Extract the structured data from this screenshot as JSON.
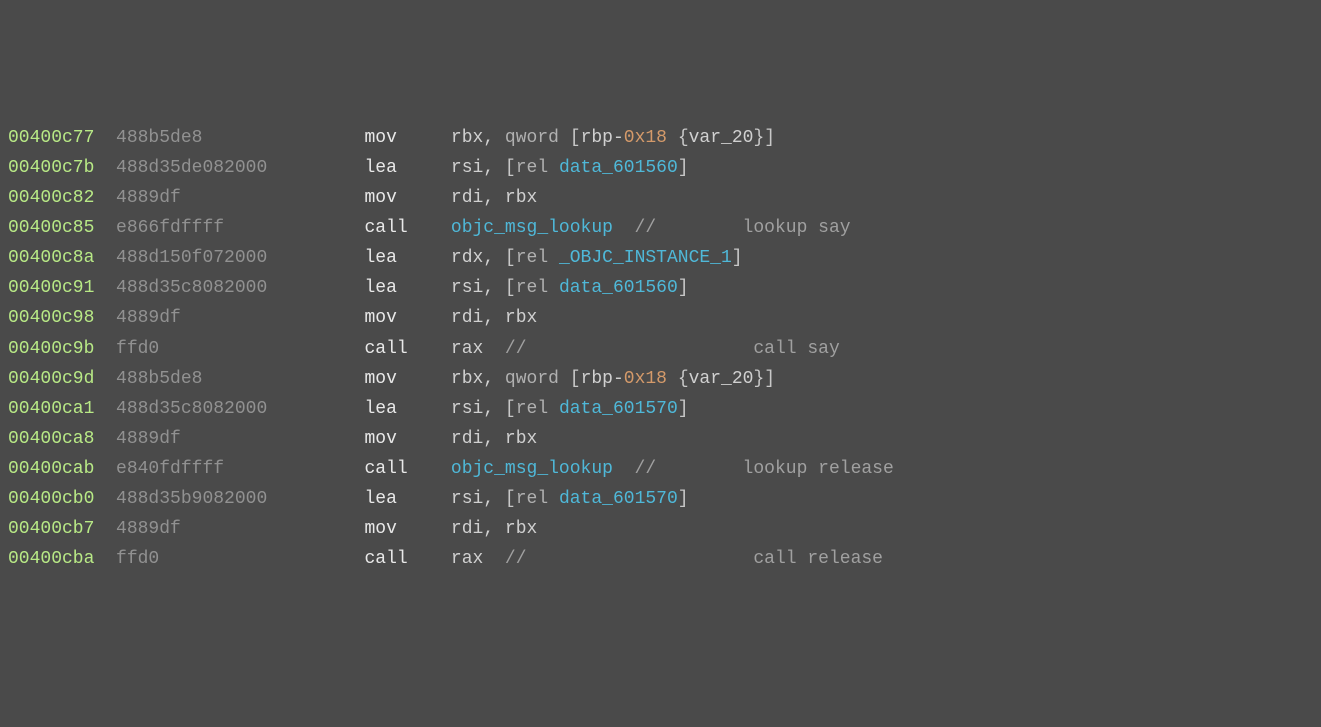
{
  "lines": [
    {
      "addr": "00400c77",
      "hex": "488b5de8",
      "mn": "mov",
      "ops": [
        {
          "t": "reg",
          "v": "rbx"
        },
        {
          "t": "tok",
          "v": ", "
        },
        {
          "t": "kw",
          "v": "qword"
        },
        {
          "t": "tok",
          "v": " "
        },
        {
          "t": "br",
          "v": "["
        },
        {
          "t": "reg",
          "v": "rbp"
        },
        {
          "t": "tok",
          "v": "-"
        },
        {
          "t": "num",
          "v": "0x18"
        },
        {
          "t": "tok",
          "v": " "
        },
        {
          "t": "br",
          "v": "{"
        },
        {
          "t": "reg",
          "v": "var_20"
        },
        {
          "t": "br",
          "v": "}"
        },
        {
          "t": "br",
          "v": "]"
        }
      ]
    },
    {
      "addr": "00400c7b",
      "hex": "488d35de082000",
      "mn": "lea",
      "ops": [
        {
          "t": "reg",
          "v": "rsi"
        },
        {
          "t": "tok",
          "v": ", "
        },
        {
          "t": "br",
          "v": "["
        },
        {
          "t": "kw",
          "v": "rel"
        },
        {
          "t": "tok",
          "v": " "
        },
        {
          "t": "sym",
          "v": "data_601560"
        },
        {
          "t": "br",
          "v": "]"
        }
      ]
    },
    {
      "addr": "00400c82",
      "hex": "4889df",
      "mn": "mov",
      "ops": [
        {
          "t": "reg",
          "v": "rdi"
        },
        {
          "t": "tok",
          "v": ", "
        },
        {
          "t": "reg",
          "v": "rbx"
        }
      ]
    },
    {
      "addr": "00400c85",
      "hex": "e866fdffff",
      "mn": "call",
      "ops": [
        {
          "t": "sym",
          "v": "objc_msg_lookup"
        },
        {
          "t": "cm",
          "v": "  //        lookup say"
        }
      ]
    },
    {
      "addr": "00400c8a",
      "hex": "488d150f072000",
      "mn": "lea",
      "ops": [
        {
          "t": "reg",
          "v": "rdx"
        },
        {
          "t": "tok",
          "v": ", "
        },
        {
          "t": "br",
          "v": "["
        },
        {
          "t": "kw",
          "v": "rel"
        },
        {
          "t": "tok",
          "v": " "
        },
        {
          "t": "sym",
          "v": "_OBJC_INSTANCE_1"
        },
        {
          "t": "br",
          "v": "]"
        }
      ]
    },
    {
      "addr": "00400c91",
      "hex": "488d35c8082000",
      "mn": "lea",
      "ops": [
        {
          "t": "reg",
          "v": "rsi"
        },
        {
          "t": "tok",
          "v": ", "
        },
        {
          "t": "br",
          "v": "["
        },
        {
          "t": "kw",
          "v": "rel"
        },
        {
          "t": "tok",
          "v": " "
        },
        {
          "t": "sym",
          "v": "data_601560"
        },
        {
          "t": "br",
          "v": "]"
        }
      ]
    },
    {
      "addr": "00400c98",
      "hex": "4889df",
      "mn": "mov",
      "ops": [
        {
          "t": "reg",
          "v": "rdi"
        },
        {
          "t": "tok",
          "v": ", "
        },
        {
          "t": "reg",
          "v": "rbx"
        }
      ]
    },
    {
      "addr": "00400c9b",
      "hex": "ffd0",
      "mn": "call",
      "ops": [
        {
          "t": "reg",
          "v": "rax"
        },
        {
          "t": "cm",
          "v": "  //                     call say"
        }
      ]
    },
    {
      "addr": "00400c9d",
      "hex": "488b5de8",
      "mn": "mov",
      "ops": [
        {
          "t": "reg",
          "v": "rbx"
        },
        {
          "t": "tok",
          "v": ", "
        },
        {
          "t": "kw",
          "v": "qword"
        },
        {
          "t": "tok",
          "v": " "
        },
        {
          "t": "br",
          "v": "["
        },
        {
          "t": "reg",
          "v": "rbp"
        },
        {
          "t": "tok",
          "v": "-"
        },
        {
          "t": "num",
          "v": "0x18"
        },
        {
          "t": "tok",
          "v": " "
        },
        {
          "t": "br",
          "v": "{"
        },
        {
          "t": "reg",
          "v": "var_20"
        },
        {
          "t": "br",
          "v": "}"
        },
        {
          "t": "br",
          "v": "]"
        }
      ]
    },
    {
      "addr": "00400ca1",
      "hex": "488d35c8082000",
      "mn": "lea",
      "ops": [
        {
          "t": "reg",
          "v": "rsi"
        },
        {
          "t": "tok",
          "v": ", "
        },
        {
          "t": "br",
          "v": "["
        },
        {
          "t": "kw",
          "v": "rel"
        },
        {
          "t": "tok",
          "v": " "
        },
        {
          "t": "sym",
          "v": "data_601570"
        },
        {
          "t": "br",
          "v": "]"
        }
      ]
    },
    {
      "addr": "00400ca8",
      "hex": "4889df",
      "mn": "mov",
      "ops": [
        {
          "t": "reg",
          "v": "rdi"
        },
        {
          "t": "tok",
          "v": ", "
        },
        {
          "t": "reg",
          "v": "rbx"
        }
      ]
    },
    {
      "addr": "00400cab",
      "hex": "e840fdffff",
      "mn": "call",
      "ops": [
        {
          "t": "sym",
          "v": "objc_msg_lookup"
        },
        {
          "t": "cm",
          "v": "  //        lookup release"
        }
      ]
    },
    {
      "addr": "00400cb0",
      "hex": "488d35b9082000",
      "mn": "lea",
      "ops": [
        {
          "t": "reg",
          "v": "rsi"
        },
        {
          "t": "tok",
          "v": ", "
        },
        {
          "t": "br",
          "v": "["
        },
        {
          "t": "kw",
          "v": "rel"
        },
        {
          "t": "tok",
          "v": " "
        },
        {
          "t": "sym",
          "v": "data_601570"
        },
        {
          "t": "br",
          "v": "]"
        }
      ]
    },
    {
      "addr": "00400cb7",
      "hex": "4889df",
      "mn": "mov",
      "ops": [
        {
          "t": "reg",
          "v": "rdi"
        },
        {
          "t": "tok",
          "v": ", "
        },
        {
          "t": "reg",
          "v": "rbx"
        }
      ]
    },
    {
      "addr": "00400cba",
      "hex": "ffd0",
      "mn": "call",
      "ops": [
        {
          "t": "reg",
          "v": "rax"
        },
        {
          "t": "cm",
          "v": "  //                     call release"
        }
      ]
    }
  ]
}
